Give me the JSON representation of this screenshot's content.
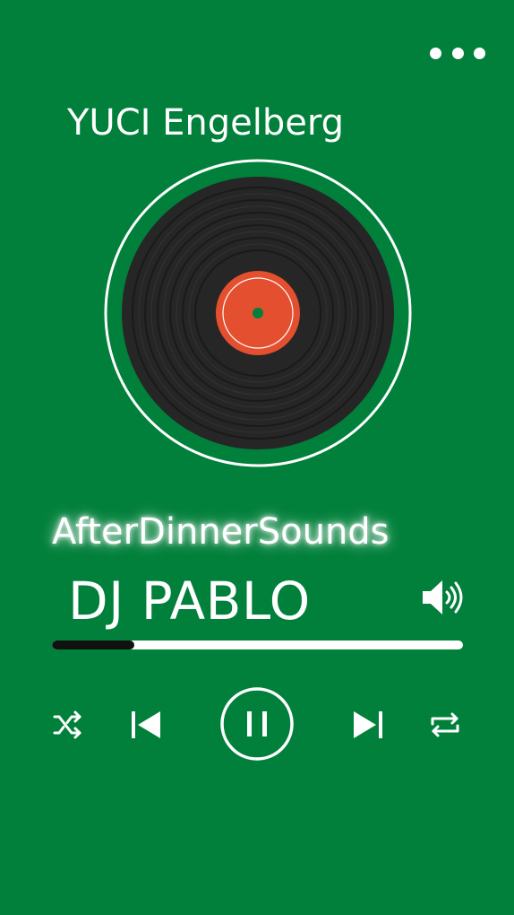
{
  "header": {
    "venue": "YUCI Engelberg",
    "more_icon": "more-horizontal-icon"
  },
  "now_playing": {
    "show_title": "AfterDinnerSounds",
    "artist": "DJ PABLO",
    "progress_fraction": 0.2,
    "state": "playing"
  },
  "colors": {
    "background": "#00803a",
    "record": "#262626",
    "record_label": "#e4502f",
    "foreground": "#ffffff"
  },
  "controls": {
    "shuffle_icon": "shuffle-icon",
    "previous_icon": "skip-previous-icon",
    "play_pause_icon": "pause-icon",
    "next_icon": "skip-next-icon",
    "repeat_icon": "repeat-icon",
    "volume_icon": "volume-icon"
  }
}
